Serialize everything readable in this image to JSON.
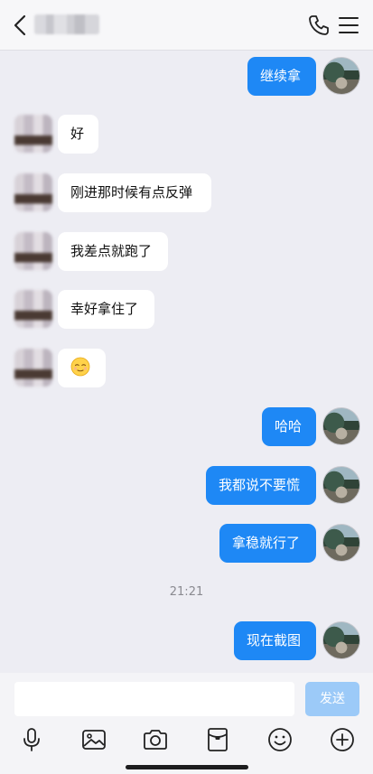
{
  "header": {
    "contact_name": "■■■■■■"
  },
  "messages": [
    {
      "direction": "out",
      "text": "继续拿"
    },
    {
      "direction": "in",
      "text": "好"
    },
    {
      "direction": "in",
      "text": "刚进那时候有点反弹"
    },
    {
      "direction": "in",
      "text": "我差点就跑了"
    },
    {
      "direction": "in",
      "text": "幸好拿住了"
    },
    {
      "direction": "in",
      "text": "",
      "emoji": "relieved-face"
    },
    {
      "direction": "out",
      "text": "哈哈"
    },
    {
      "direction": "out",
      "text": "我都说不要慌"
    },
    {
      "direction": "out",
      "text": "拿稳就行了"
    },
    {
      "direction": "out",
      "text": "现在截图"
    }
  ],
  "timestamp": "21:21",
  "composer": {
    "input_value": "",
    "send_label": "发送"
  },
  "toolbar": [
    "microphone-icon",
    "image-icon",
    "camera-icon",
    "red-packet-icon",
    "emoji-icon",
    "plus-icon"
  ],
  "colors": {
    "outgoing_bubble": "#1e88f5",
    "incoming_bubble": "#ffffff",
    "background": "#ededf3",
    "send_button_disabled": "#9ccaf8"
  }
}
